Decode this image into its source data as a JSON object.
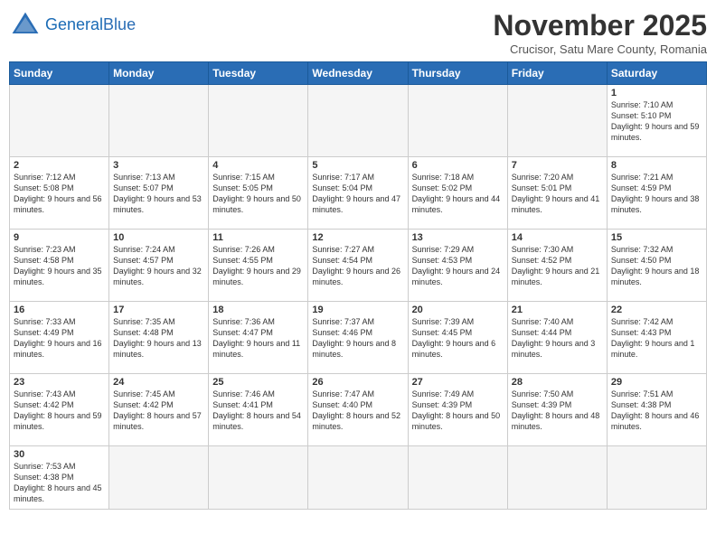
{
  "header": {
    "logo_general": "General",
    "logo_blue": "Blue",
    "month_title": "November 2025",
    "subtitle": "Crucisor, Satu Mare County, Romania"
  },
  "weekdays": [
    "Sunday",
    "Monday",
    "Tuesday",
    "Wednesday",
    "Thursday",
    "Friday",
    "Saturday"
  ],
  "weeks": [
    [
      {
        "day": "",
        "info": ""
      },
      {
        "day": "",
        "info": ""
      },
      {
        "day": "",
        "info": ""
      },
      {
        "day": "",
        "info": ""
      },
      {
        "day": "",
        "info": ""
      },
      {
        "day": "",
        "info": ""
      },
      {
        "day": "1",
        "info": "Sunrise: 7:10 AM\nSunset: 5:10 PM\nDaylight: 9 hours and 59 minutes."
      }
    ],
    [
      {
        "day": "2",
        "info": "Sunrise: 7:12 AM\nSunset: 5:08 PM\nDaylight: 9 hours and 56 minutes."
      },
      {
        "day": "3",
        "info": "Sunrise: 7:13 AM\nSunset: 5:07 PM\nDaylight: 9 hours and 53 minutes."
      },
      {
        "day": "4",
        "info": "Sunrise: 7:15 AM\nSunset: 5:05 PM\nDaylight: 9 hours and 50 minutes."
      },
      {
        "day": "5",
        "info": "Sunrise: 7:17 AM\nSunset: 5:04 PM\nDaylight: 9 hours and 47 minutes."
      },
      {
        "day": "6",
        "info": "Sunrise: 7:18 AM\nSunset: 5:02 PM\nDaylight: 9 hours and 44 minutes."
      },
      {
        "day": "7",
        "info": "Sunrise: 7:20 AM\nSunset: 5:01 PM\nDaylight: 9 hours and 41 minutes."
      },
      {
        "day": "8",
        "info": "Sunrise: 7:21 AM\nSunset: 4:59 PM\nDaylight: 9 hours and 38 minutes."
      }
    ],
    [
      {
        "day": "9",
        "info": "Sunrise: 7:23 AM\nSunset: 4:58 PM\nDaylight: 9 hours and 35 minutes."
      },
      {
        "day": "10",
        "info": "Sunrise: 7:24 AM\nSunset: 4:57 PM\nDaylight: 9 hours and 32 minutes."
      },
      {
        "day": "11",
        "info": "Sunrise: 7:26 AM\nSunset: 4:55 PM\nDaylight: 9 hours and 29 minutes."
      },
      {
        "day": "12",
        "info": "Sunrise: 7:27 AM\nSunset: 4:54 PM\nDaylight: 9 hours and 26 minutes."
      },
      {
        "day": "13",
        "info": "Sunrise: 7:29 AM\nSunset: 4:53 PM\nDaylight: 9 hours and 24 minutes."
      },
      {
        "day": "14",
        "info": "Sunrise: 7:30 AM\nSunset: 4:52 PM\nDaylight: 9 hours and 21 minutes."
      },
      {
        "day": "15",
        "info": "Sunrise: 7:32 AM\nSunset: 4:50 PM\nDaylight: 9 hours and 18 minutes."
      }
    ],
    [
      {
        "day": "16",
        "info": "Sunrise: 7:33 AM\nSunset: 4:49 PM\nDaylight: 9 hours and 16 minutes."
      },
      {
        "day": "17",
        "info": "Sunrise: 7:35 AM\nSunset: 4:48 PM\nDaylight: 9 hours and 13 minutes."
      },
      {
        "day": "18",
        "info": "Sunrise: 7:36 AM\nSunset: 4:47 PM\nDaylight: 9 hours and 11 minutes."
      },
      {
        "day": "19",
        "info": "Sunrise: 7:37 AM\nSunset: 4:46 PM\nDaylight: 9 hours and 8 minutes."
      },
      {
        "day": "20",
        "info": "Sunrise: 7:39 AM\nSunset: 4:45 PM\nDaylight: 9 hours and 6 minutes."
      },
      {
        "day": "21",
        "info": "Sunrise: 7:40 AM\nSunset: 4:44 PM\nDaylight: 9 hours and 3 minutes."
      },
      {
        "day": "22",
        "info": "Sunrise: 7:42 AM\nSunset: 4:43 PM\nDaylight: 9 hours and 1 minute."
      }
    ],
    [
      {
        "day": "23",
        "info": "Sunrise: 7:43 AM\nSunset: 4:42 PM\nDaylight: 8 hours and 59 minutes."
      },
      {
        "day": "24",
        "info": "Sunrise: 7:45 AM\nSunset: 4:42 PM\nDaylight: 8 hours and 57 minutes."
      },
      {
        "day": "25",
        "info": "Sunrise: 7:46 AM\nSunset: 4:41 PM\nDaylight: 8 hours and 54 minutes."
      },
      {
        "day": "26",
        "info": "Sunrise: 7:47 AM\nSunset: 4:40 PM\nDaylight: 8 hours and 52 minutes."
      },
      {
        "day": "27",
        "info": "Sunrise: 7:49 AM\nSunset: 4:39 PM\nDaylight: 8 hours and 50 minutes."
      },
      {
        "day": "28",
        "info": "Sunrise: 7:50 AM\nSunset: 4:39 PM\nDaylight: 8 hours and 48 minutes."
      },
      {
        "day": "29",
        "info": "Sunrise: 7:51 AM\nSunset: 4:38 PM\nDaylight: 8 hours and 46 minutes."
      }
    ],
    [
      {
        "day": "30",
        "info": "Sunrise: 7:53 AM\nSunset: 4:38 PM\nDaylight: 8 hours and 45 minutes."
      },
      {
        "day": "",
        "info": ""
      },
      {
        "day": "",
        "info": ""
      },
      {
        "day": "",
        "info": ""
      },
      {
        "day": "",
        "info": ""
      },
      {
        "day": "",
        "info": ""
      },
      {
        "day": "",
        "info": ""
      }
    ]
  ]
}
